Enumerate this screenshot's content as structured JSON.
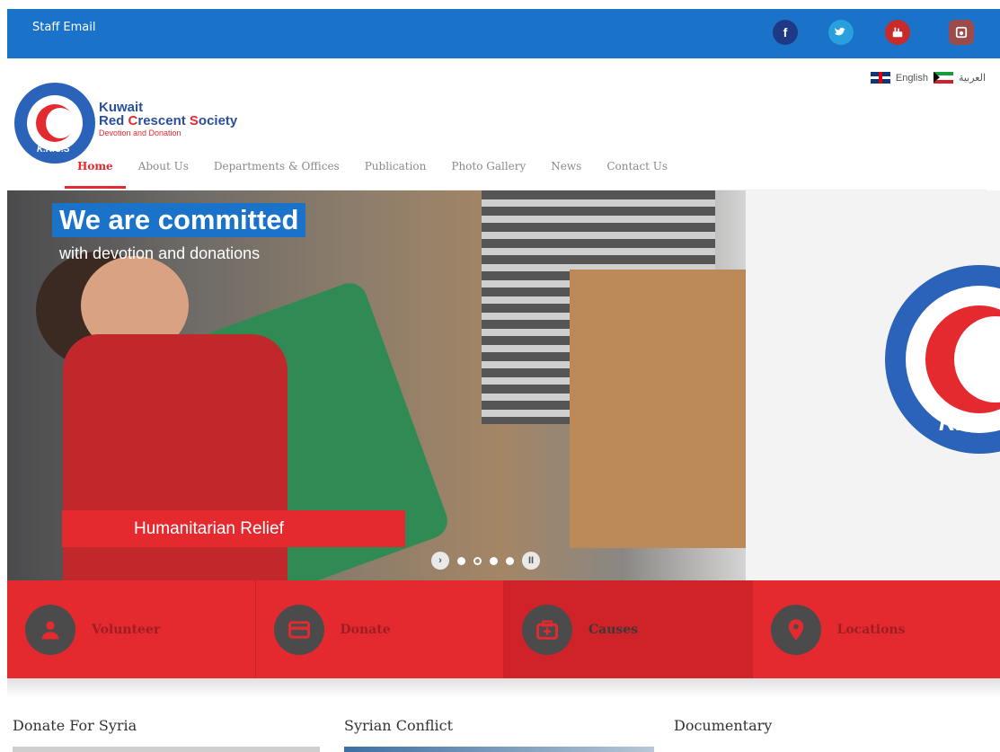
{
  "topbar": {
    "staff_email": "Staff Email",
    "social": [
      {
        "icon": "facebook-icon",
        "glyph": "f",
        "color": "#1e3a86"
      },
      {
        "icon": "twitter-icon",
        "glyph": "",
        "color": "#27a0dd"
      },
      {
        "icon": "youtube-icon",
        "glyph": "",
        "color": "#c92a2a"
      },
      {
        "icon": "instagram-icon",
        "glyph": "",
        "color": "#9c4a4a"
      }
    ]
  },
  "language": {
    "english": "English",
    "arabic": "العربية"
  },
  "logo": {
    "line1": "Kuwait",
    "line2_part1": "Red ",
    "line2_part2": "C",
    "line2_part3": "rescent ",
    "line2_part4": "S",
    "line2_part5": "ociety",
    "tagline": "Devotion and Donation",
    "badge_text": "K.R.C.S"
  },
  "nav": {
    "items": [
      "Home",
      "About Us",
      "Departments & Offices",
      "Publication",
      "Photo Gallery",
      "News",
      "Contact Us"
    ],
    "active_index": 0
  },
  "hero": {
    "title": "We are committed",
    "subtitle": "with devotion and donations",
    "badge": "Humanitarian Relief",
    "emblem_text": "K.R.",
    "slides_count": 4,
    "active_slide": 1
  },
  "features": [
    {
      "label": "Volunteer",
      "icon": "volunteer-icon"
    },
    {
      "label": "Donate",
      "icon": "donate-icon"
    },
    {
      "label": "Causes",
      "icon": "causes-icon"
    },
    {
      "label": "Locations",
      "icon": "location-icon"
    }
  ],
  "sections": [
    "Donate For Syria",
    "Syrian Conflict",
    "Documentary"
  ],
  "colors": {
    "brand_blue": "#1a73c9",
    "brand_red": "#e52a2f"
  }
}
